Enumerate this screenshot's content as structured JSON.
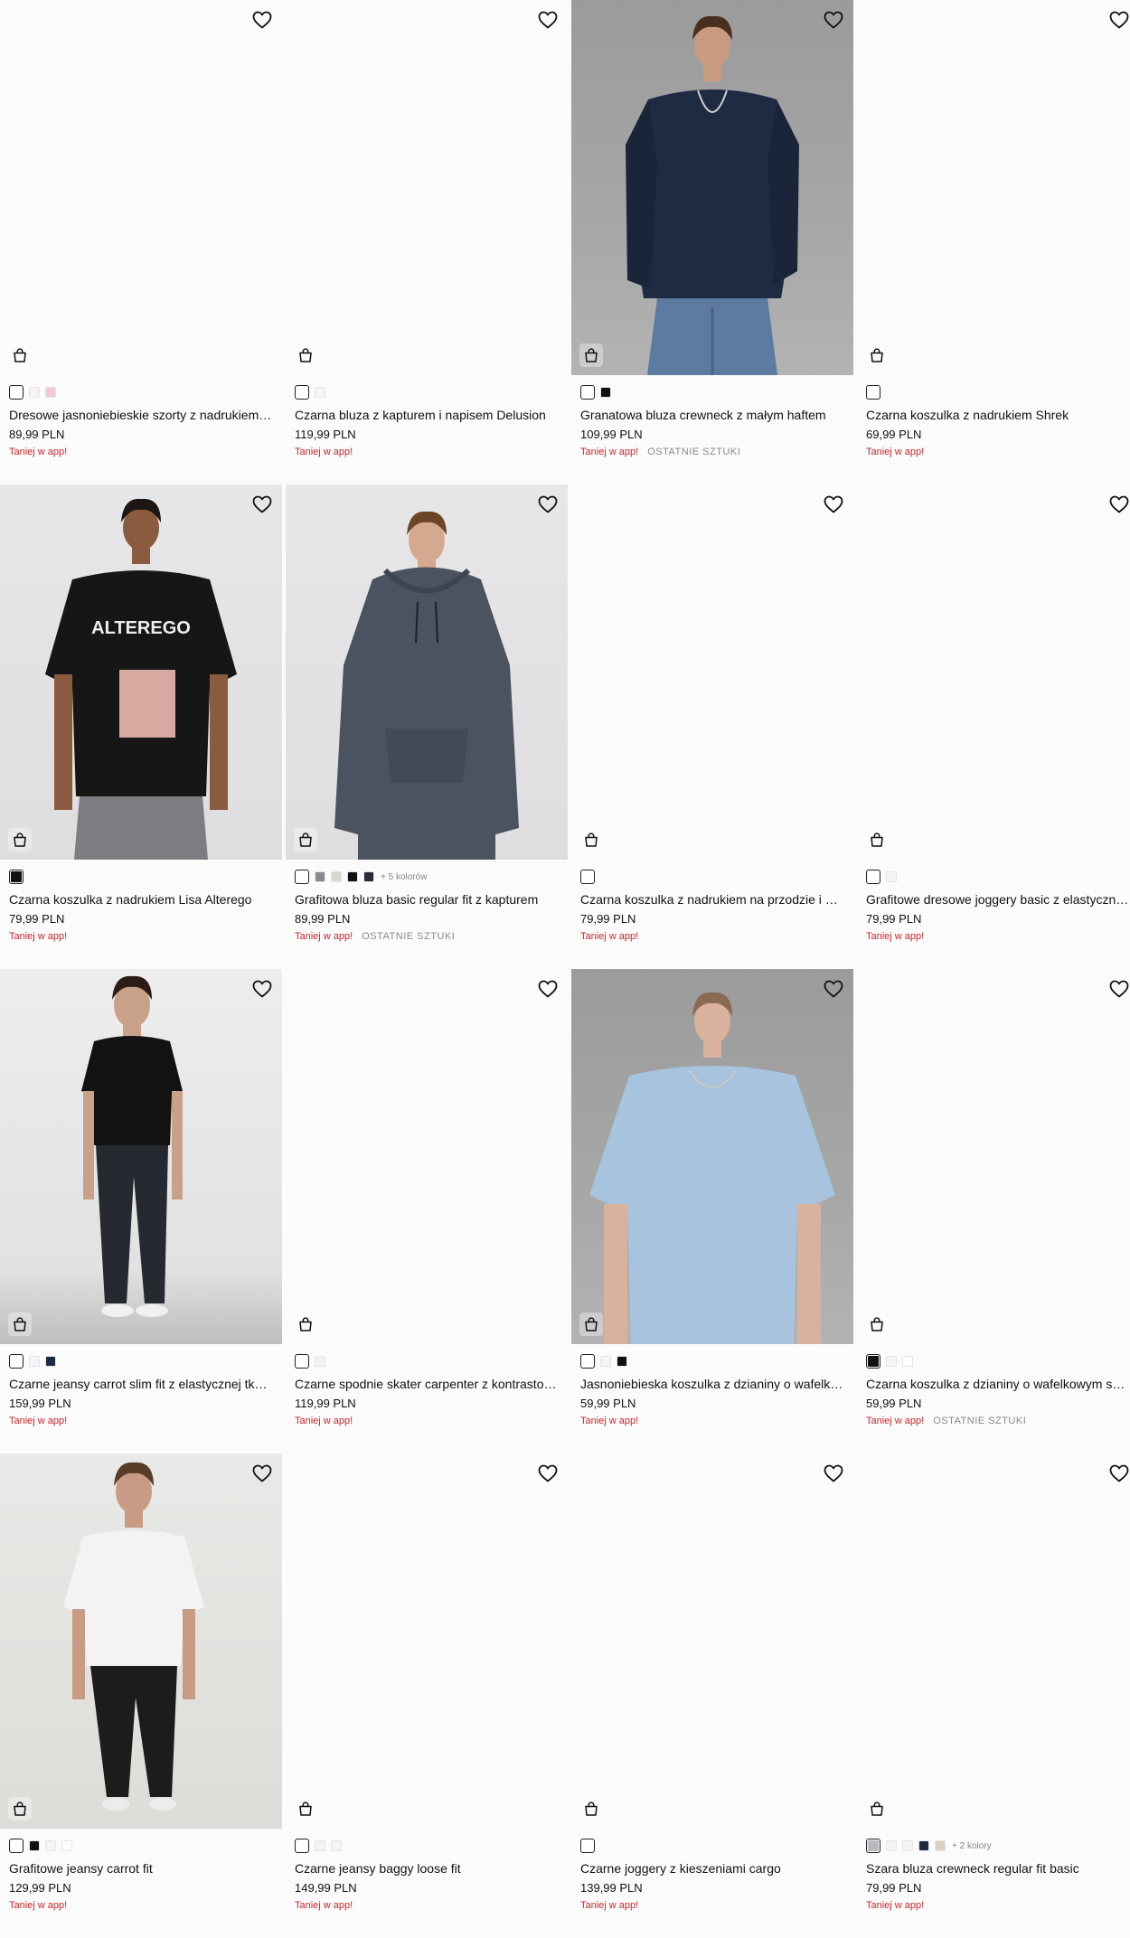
{
  "products": [
    {
      "name": "Dresowe jasnoniebieskie szorty z nadrukiem na nogawce",
      "price": "89,99 PLN",
      "promo": "Taniej w app!",
      "last": "",
      "image": "blank",
      "swatches": [
        "#ffffff",
        "#f4f4f4",
        "#f2c9d3"
      ],
      "selected": 0,
      "more": ""
    },
    {
      "name": "Czarna bluza z kapturem i napisem Delusion",
      "price": "119,99 PLN",
      "promo": "Taniej w app!",
      "last": "",
      "image": "blank",
      "swatches": [
        "#ffffff",
        "#f4f4f4"
      ],
      "selected": 0,
      "more": ""
    },
    {
      "name": "Granatowa bluza crewneck z małym haftem",
      "price": "109,99 PLN",
      "promo": "Taniej w app!",
      "last": "OSTATNIE SZTUKI",
      "image": "navy-sweatshirt",
      "swatches": [
        "#ffffff",
        "#111111"
      ],
      "selected": 0,
      "more": ""
    },
    {
      "name": "Czarna koszulka z nadrukiem Shrek",
      "price": "69,99 PLN",
      "promo": "Taniej w app!",
      "last": "",
      "image": "blank",
      "swatches": [
        "#ffffff"
      ],
      "selected": 0,
      "more": ""
    },
    {
      "name": "Czarna koszulka z nadrukiem Lisa Alterego",
      "price": "79,99 PLN",
      "promo": "Taniej w app!",
      "last": "",
      "image": "black-tee-print",
      "swatches": [
        "#111111"
      ],
      "selected": 0,
      "more": ""
    },
    {
      "name": "Grafitowa bluza basic regular fit z kapturem",
      "price": "89,99 PLN",
      "promo": "Taniej w app!",
      "last": "OSTATNIE SZTUKI",
      "image": "graphite-hoodie",
      "swatches": [
        "#ffffff",
        "#8a8a8a",
        "#d9d6cf",
        "#111111",
        "#2a2a3a"
      ],
      "selected": 0,
      "more": "+ 5 kolorów"
    },
    {
      "name": "Czarna koszulka z nadrukiem na przodzie i plecach",
      "price": "79,99 PLN",
      "promo": "Taniej w app!",
      "last": "",
      "image": "blank",
      "swatches": [
        "#ffffff"
      ],
      "selected": 0,
      "more": ""
    },
    {
      "name": "Grafitowe dresowe joggery basic z elastycznymi ściągaczami",
      "price": "79,99 PLN",
      "promo": "Taniej w app!",
      "last": "",
      "image": "blank",
      "swatches": [
        "#ffffff",
        "#f4f4f4"
      ],
      "selected": 0,
      "more": ""
    },
    {
      "name": "Czarne jeansy carrot slim fit z elastycznej tkaniny",
      "price": "159,99 PLN",
      "promo": "Taniej w app!",
      "last": "",
      "image": "black-jeans",
      "swatches": [
        "#ffffff",
        "#f4f4f4",
        "#1d2a44"
      ],
      "selected": 0,
      "more": ""
    },
    {
      "name": "Czarne spodnie skater carpenter z kontrastowymi szwami",
      "price": "119,99 PLN",
      "promo": "Taniej w app!",
      "last": "",
      "image": "blank",
      "swatches": [
        "#ffffff",
        "#f4f4f4"
      ],
      "selected": 0,
      "more": ""
    },
    {
      "name": "Jasnoniebieska koszulka z dzianiny o wafelkowym splocie",
      "price": "59,99 PLN",
      "promo": "Taniej w app!",
      "last": "",
      "image": "blue-waffle-tee",
      "swatches": [
        "#ffffff",
        "#f4f4f4",
        "#111111"
      ],
      "selected": 0,
      "more": ""
    },
    {
      "name": "Czarna koszulka z dzianiny o wafelkowym splocie",
      "price": "59,99 PLN",
      "promo": "Taniej w app!",
      "last": "OSTATNIE SZTUKI",
      "image": "blank",
      "swatches": [
        "#111111",
        "#f4f4f4",
        "#ffffff"
      ],
      "selected": 0,
      "more": ""
    },
    {
      "name": "Grafitowe jeansy carrot fit",
      "price": "129,99 PLN",
      "promo": "Taniej w app!",
      "last": "",
      "image": "white-tee-jeans",
      "swatches": [
        "#ffffff",
        "#111111",
        "#f4f4f4",
        "#ffffff"
      ],
      "selected": 0,
      "more": ""
    },
    {
      "name": "Czarne jeansy baggy loose fit",
      "price": "149,99 PLN",
      "promo": "Taniej w app!",
      "last": "",
      "image": "blank",
      "swatches": [
        "#ffffff",
        "#f4f4f4",
        "#f4f4f4"
      ],
      "selected": 0,
      "more": ""
    },
    {
      "name": "Czarne joggery z kieszeniami cargo",
      "price": "139,99 PLN",
      "promo": "Taniej w app!",
      "last": "",
      "image": "blank",
      "swatches": [
        "#ffffff"
      ],
      "selected": 0,
      "more": ""
    },
    {
      "name": "Szara bluza crewneck regular fit basic",
      "price": "79,99 PLN",
      "promo": "Taniej w app!",
      "last": "",
      "image": "blank",
      "swatches": [
        "#b9b9bf",
        "#f4f4f4",
        "#f4f4f4",
        "#1d2a44",
        "#ddd0bf"
      ],
      "selected": 0,
      "more": "+ 2 kolory"
    }
  ],
  "icons": {
    "wishlist": "heart-icon",
    "cart": "shopping-bag-icon"
  },
  "print_text": "ALTEREGO"
}
